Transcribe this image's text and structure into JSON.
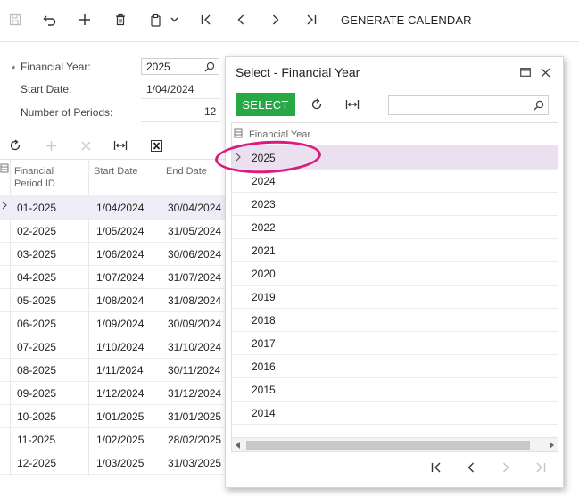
{
  "toolbar": {
    "icons": [
      "save-icon",
      "undo-icon",
      "add-icon",
      "delete-icon",
      "copy-paste-icon",
      "chevron-down-icon",
      "first-icon",
      "previous-icon",
      "next-icon",
      "last-icon"
    ],
    "generate_label": "GENERATE CALENDAR"
  },
  "form": {
    "financial_year_label": "Financial Year:",
    "financial_year_value": "2025",
    "start_date_label": "Start Date:",
    "start_date_value": "1/04/2024",
    "periods_label": "Number of Periods:",
    "periods_value": "12",
    "required_marker": "*"
  },
  "grid": {
    "headers": {
      "period_id": "Financial Period ID",
      "start_date": "Start Date",
      "end_date": "End Date"
    },
    "rows": [
      {
        "id": "01-2025",
        "start": "1/04/2024",
        "end": "30/04/2024"
      },
      {
        "id": "02-2025",
        "start": "1/05/2024",
        "end": "31/05/2024"
      },
      {
        "id": "03-2025",
        "start": "1/06/2024",
        "end": "30/06/2024"
      },
      {
        "id": "04-2025",
        "start": "1/07/2024",
        "end": "31/07/2024"
      },
      {
        "id": "05-2025",
        "start": "1/08/2024",
        "end": "31/08/2024"
      },
      {
        "id": "06-2025",
        "start": "1/09/2024",
        "end": "30/09/2024"
      },
      {
        "id": "07-2025",
        "start": "1/10/2024",
        "end": "31/10/2024"
      },
      {
        "id": "08-2025",
        "start": "1/11/2024",
        "end": "30/11/2024"
      },
      {
        "id": "09-2025",
        "start": "1/12/2024",
        "end": "31/12/2024"
      },
      {
        "id": "10-2025",
        "start": "1/01/2025",
        "end": "31/01/2025"
      },
      {
        "id": "11-2025",
        "start": "1/02/2025",
        "end": "28/02/2025"
      },
      {
        "id": "12-2025",
        "start": "1/03/2025",
        "end": "31/03/2025"
      }
    ]
  },
  "dialog": {
    "title": "Select - Financial Year",
    "select_label": "SELECT",
    "search_value": "",
    "column_header": "Financial Year",
    "years": [
      "2025",
      "2024",
      "2023",
      "2022",
      "2021",
      "2020",
      "2019",
      "2018",
      "2017",
      "2016",
      "2015",
      "2014"
    ],
    "selected_year": "2025"
  },
  "colors": {
    "accent_green": "#27a745",
    "selection": "#ebe0f0",
    "highlight_circle": "#d81b7c"
  }
}
